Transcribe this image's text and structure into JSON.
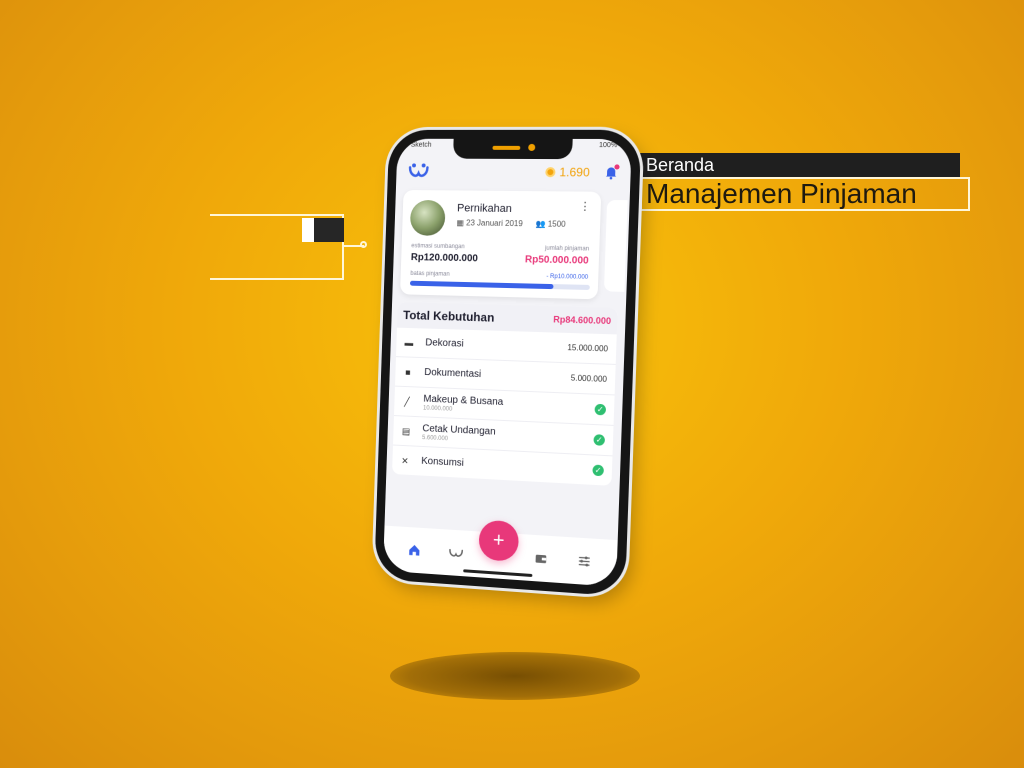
{
  "callout": {
    "title": "Beranda",
    "subtitle": "Manajemen Pinjaman"
  },
  "status_bar": {
    "carrier": "Sketch",
    "battery": "100%"
  },
  "header": {
    "coins": "1.690"
  },
  "event": {
    "title": "Pernikahan",
    "date": "23 Januari 2019",
    "guests": "1500",
    "estimate_label": "estimasi sumbangan",
    "estimate_value": "Rp120.000.000",
    "loan_label": "jumlah pinjaman",
    "loan_value": "Rp50.000.000",
    "limit_label": "batas pinjaman",
    "limit_value": "- Rp10.000.000",
    "limit_progress": 0.8
  },
  "needs": {
    "title": "Total Kebutuhan",
    "total": "Rp84.600.000",
    "items": [
      {
        "name": "Dekorasi",
        "amount": "15.000.000",
        "sub": "",
        "checked": false
      },
      {
        "name": "Dokumentasi",
        "amount": "5.000.000",
        "sub": "",
        "checked": false
      },
      {
        "name": "Makeup & Busana",
        "amount": "",
        "sub": "10.000.000",
        "checked": true
      },
      {
        "name": "Cetak Undangan",
        "amount": "",
        "sub": "5.600.000",
        "checked": true
      },
      {
        "name": "Konsumsi",
        "amount": "",
        "sub": "",
        "checked": true
      }
    ]
  },
  "fab": {
    "label": "+"
  },
  "colors": {
    "background": "#f5b20a",
    "accent": "#3a62e8",
    "pink": "#e8387a",
    "success": "#2fbf71"
  }
}
